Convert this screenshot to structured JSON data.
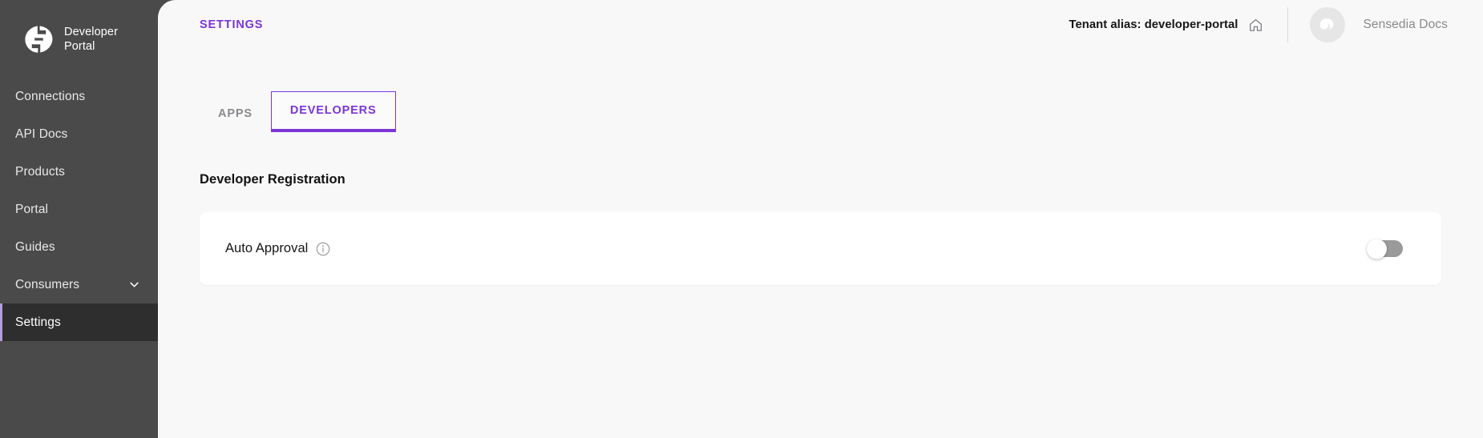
{
  "sidebar": {
    "brand": {
      "name": "Developer\nPortal",
      "logo_icon": "developer-portal-logo"
    },
    "items": [
      {
        "label": "Connections",
        "icon": null,
        "active": false
      },
      {
        "label": "API Docs",
        "icon": null,
        "active": false
      },
      {
        "label": "Products",
        "icon": null,
        "active": false
      },
      {
        "label": "Portal",
        "icon": null,
        "active": false
      },
      {
        "label": "Guides",
        "icon": null,
        "active": false
      },
      {
        "label": "Consumers",
        "icon": "chevron-down-icon",
        "active": false
      },
      {
        "label": "Settings",
        "icon": null,
        "active": true
      }
    ]
  },
  "header": {
    "page_kicker": "SETTINGS",
    "tenant_label": "Tenant alias: developer-portal",
    "home_icon": "home-icon",
    "avatar_icon": "sensedia-avatar",
    "account_name": "Sensedia Docs"
  },
  "main": {
    "tabs": [
      {
        "label": "APPS",
        "active": false
      },
      {
        "label": "DEVELOPERS",
        "active": true
      }
    ],
    "section_title": "Developer Registration",
    "card": {
      "label": "Auto Approval",
      "info_icon": "info-icon",
      "toggle_state": "off"
    }
  },
  "colors": {
    "accent": "#7c35d6",
    "sidebar_bg": "#4a4a4a",
    "sidebar_active_bg": "#2e2e2e",
    "sidebar_active_bar": "#b39ddb",
    "panel_bg": "#f8f8f9",
    "card_bg": "#ffffff",
    "muted_text": "#8a8a8e",
    "toggle_off_track": "#9a9a9a"
  }
}
